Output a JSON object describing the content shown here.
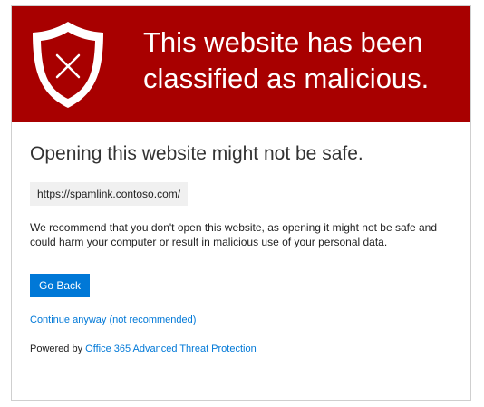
{
  "banner": {
    "background_color": "#a80000",
    "icon": "shield-x-icon",
    "headline": "This website has been classified as malicious."
  },
  "subheading": "Opening this website might not be safe.",
  "url": "https://spamlink.contoso.com/",
  "message": "We recommend that you don't open this website, as opening it might not be safe and could harm your computer or result in malicious use of your personal data.",
  "actions": {
    "go_back_label": "Go Back",
    "continue_label": "Continue anyway (not recommended)"
  },
  "footer": {
    "powered_by_prefix": "Powered by",
    "powered_by_link": "Office 365 Advanced Threat Protection"
  },
  "colors": {
    "accent": "#0078d7",
    "danger": "#a80000"
  }
}
